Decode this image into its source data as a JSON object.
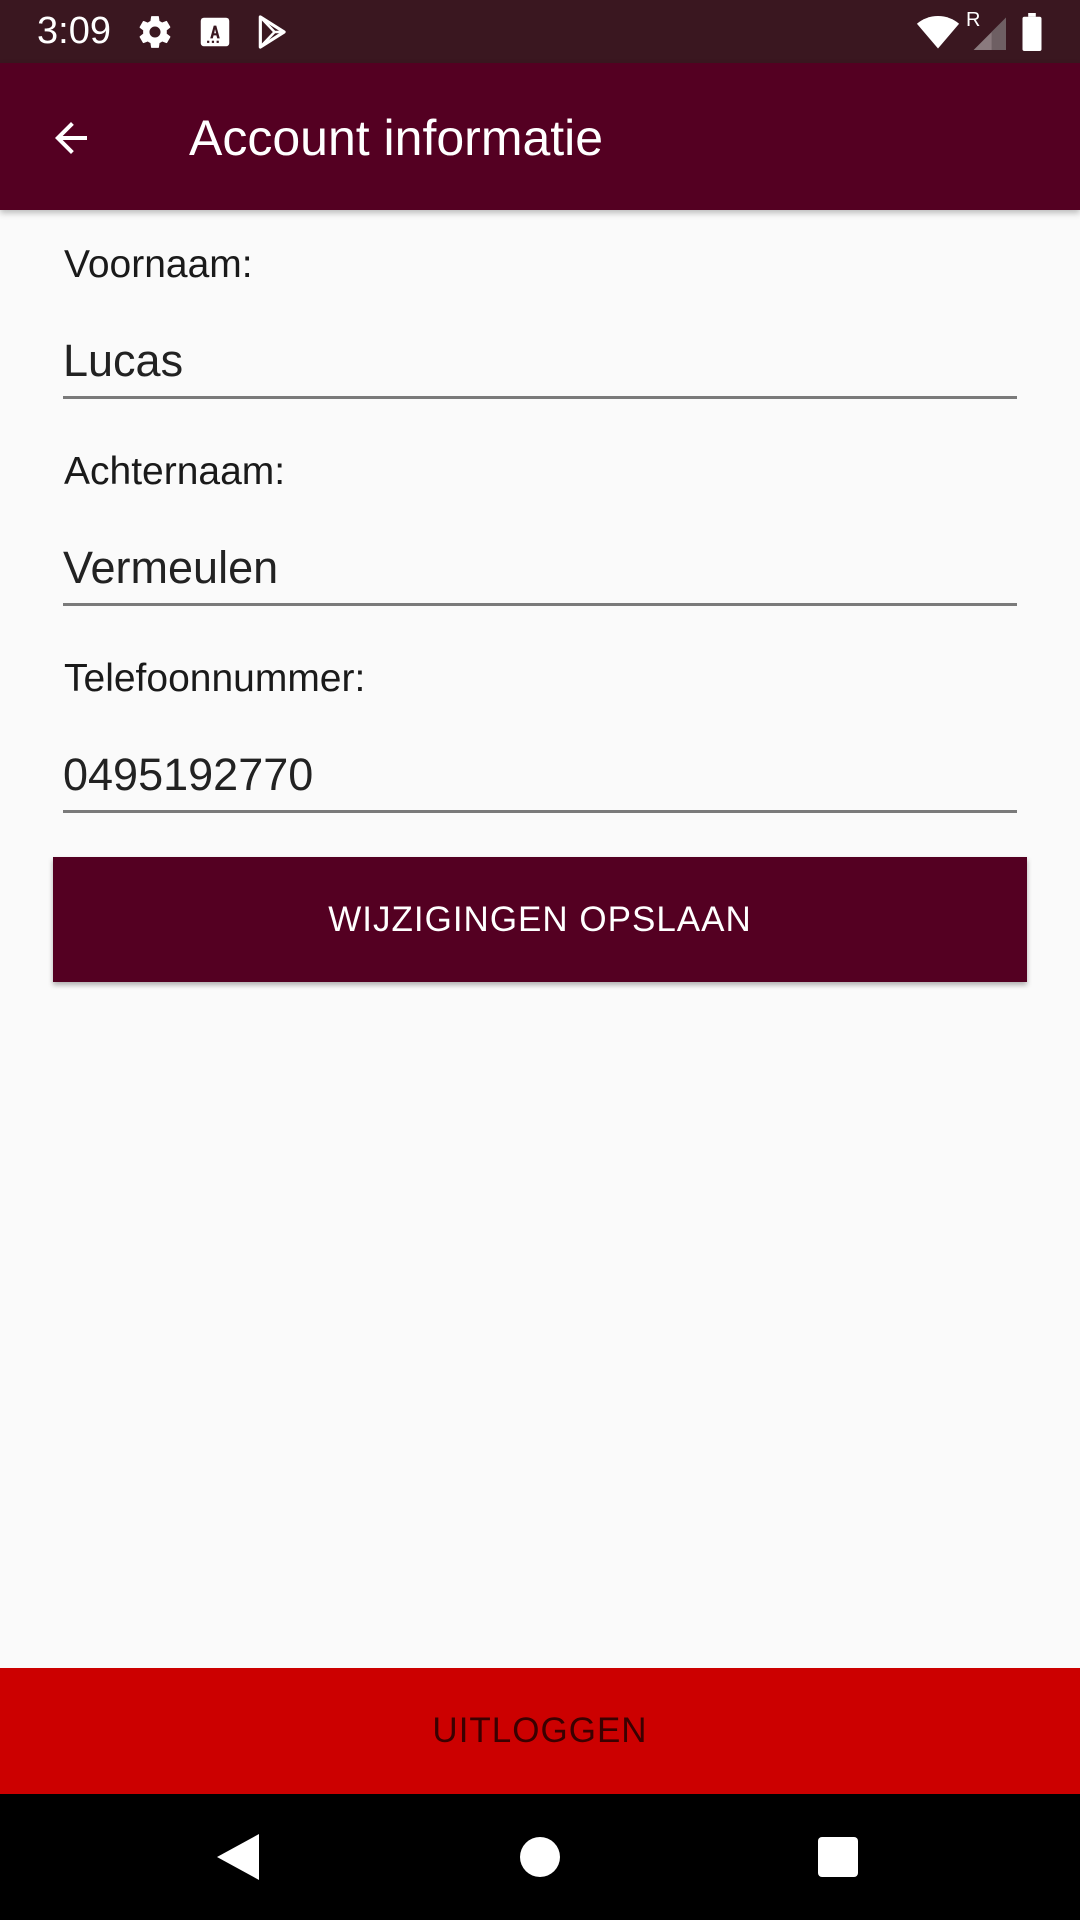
{
  "status_bar": {
    "time": "3:09",
    "icons": [
      "settings-icon",
      "font-a-icon",
      "play-store-icon",
      "wifi-icon",
      "roaming-r-icon",
      "signal-icon",
      "battery-icon"
    ],
    "roaming_label": "R"
  },
  "app_bar": {
    "title": "Account informatie",
    "back_icon": "arrow-back-icon",
    "color": "#540022"
  },
  "form": {
    "first_name": {
      "label": "Voornaam:",
      "value": "Lucas"
    },
    "last_name": {
      "label": "Achternaam:",
      "value": "Vermeulen"
    },
    "phone": {
      "label": "Telefoonnummer:",
      "value": "0495192770"
    }
  },
  "actions": {
    "save_label": "WIJZIGINGEN OPSLAAN",
    "logout_label": "UITLOGGEN",
    "save_color": "#540022",
    "logout_color": "#cc0000"
  },
  "nav_bar": {
    "icons": [
      "nav-back-icon",
      "nav-home-icon",
      "nav-recents-icon"
    ]
  }
}
